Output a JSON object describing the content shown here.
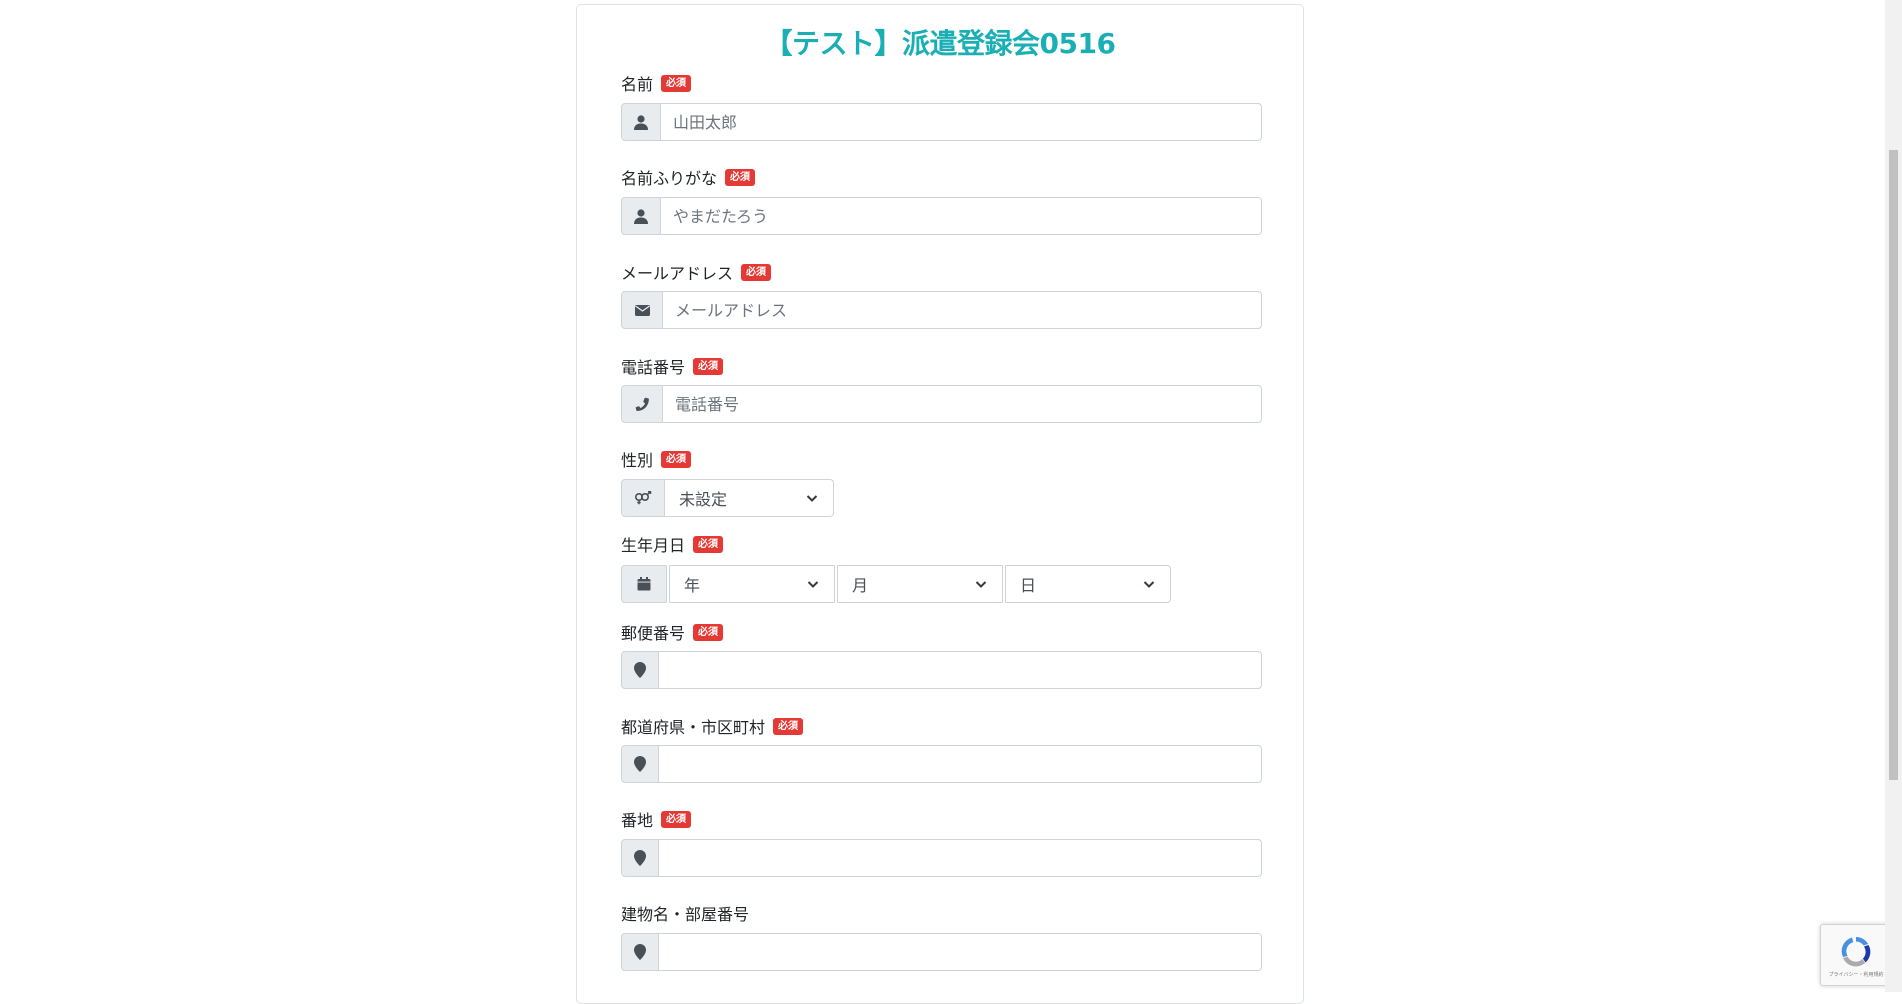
{
  "form": {
    "title": "【テスト】派遣登録会0516",
    "required_badge": "必須",
    "fields": {
      "name": {
        "label": "名前",
        "placeholder": "山田太郎",
        "icon": "user-icon"
      },
      "furigana": {
        "label": "名前ふりがな",
        "placeholder": "やまだたろう",
        "icon": "user-icon"
      },
      "email": {
        "label": "メールアドレス",
        "placeholder": "メールアドレス",
        "icon": "envelope-icon"
      },
      "phone": {
        "label": "電話番号",
        "placeholder": "電話番号",
        "icon": "phone-icon"
      },
      "gender": {
        "label": "性別",
        "selected": "未設定",
        "icon": "gender-icon"
      },
      "birthday": {
        "label": "生年月日",
        "year": "年",
        "month": "月",
        "day": "日",
        "icon": "calendar-icon"
      },
      "postal": {
        "label": "郵便番号",
        "placeholder": "",
        "icon": "map-marker-icon"
      },
      "prefecture_city": {
        "label": "都道府県・市区町村",
        "placeholder": "",
        "icon": "map-marker-icon"
      },
      "address": {
        "label": "番地",
        "placeholder": "",
        "icon": "map-marker-icon"
      },
      "building": {
        "label": "建物名・部屋番号",
        "placeholder": "",
        "icon": "map-marker-icon"
      }
    }
  },
  "recaptcha": {
    "text": "プライバシー・利用規約"
  },
  "colors": {
    "title": "#1aafb5",
    "required": "#e53935",
    "addon_bg": "#e9ecef",
    "border": "#ced4da"
  }
}
